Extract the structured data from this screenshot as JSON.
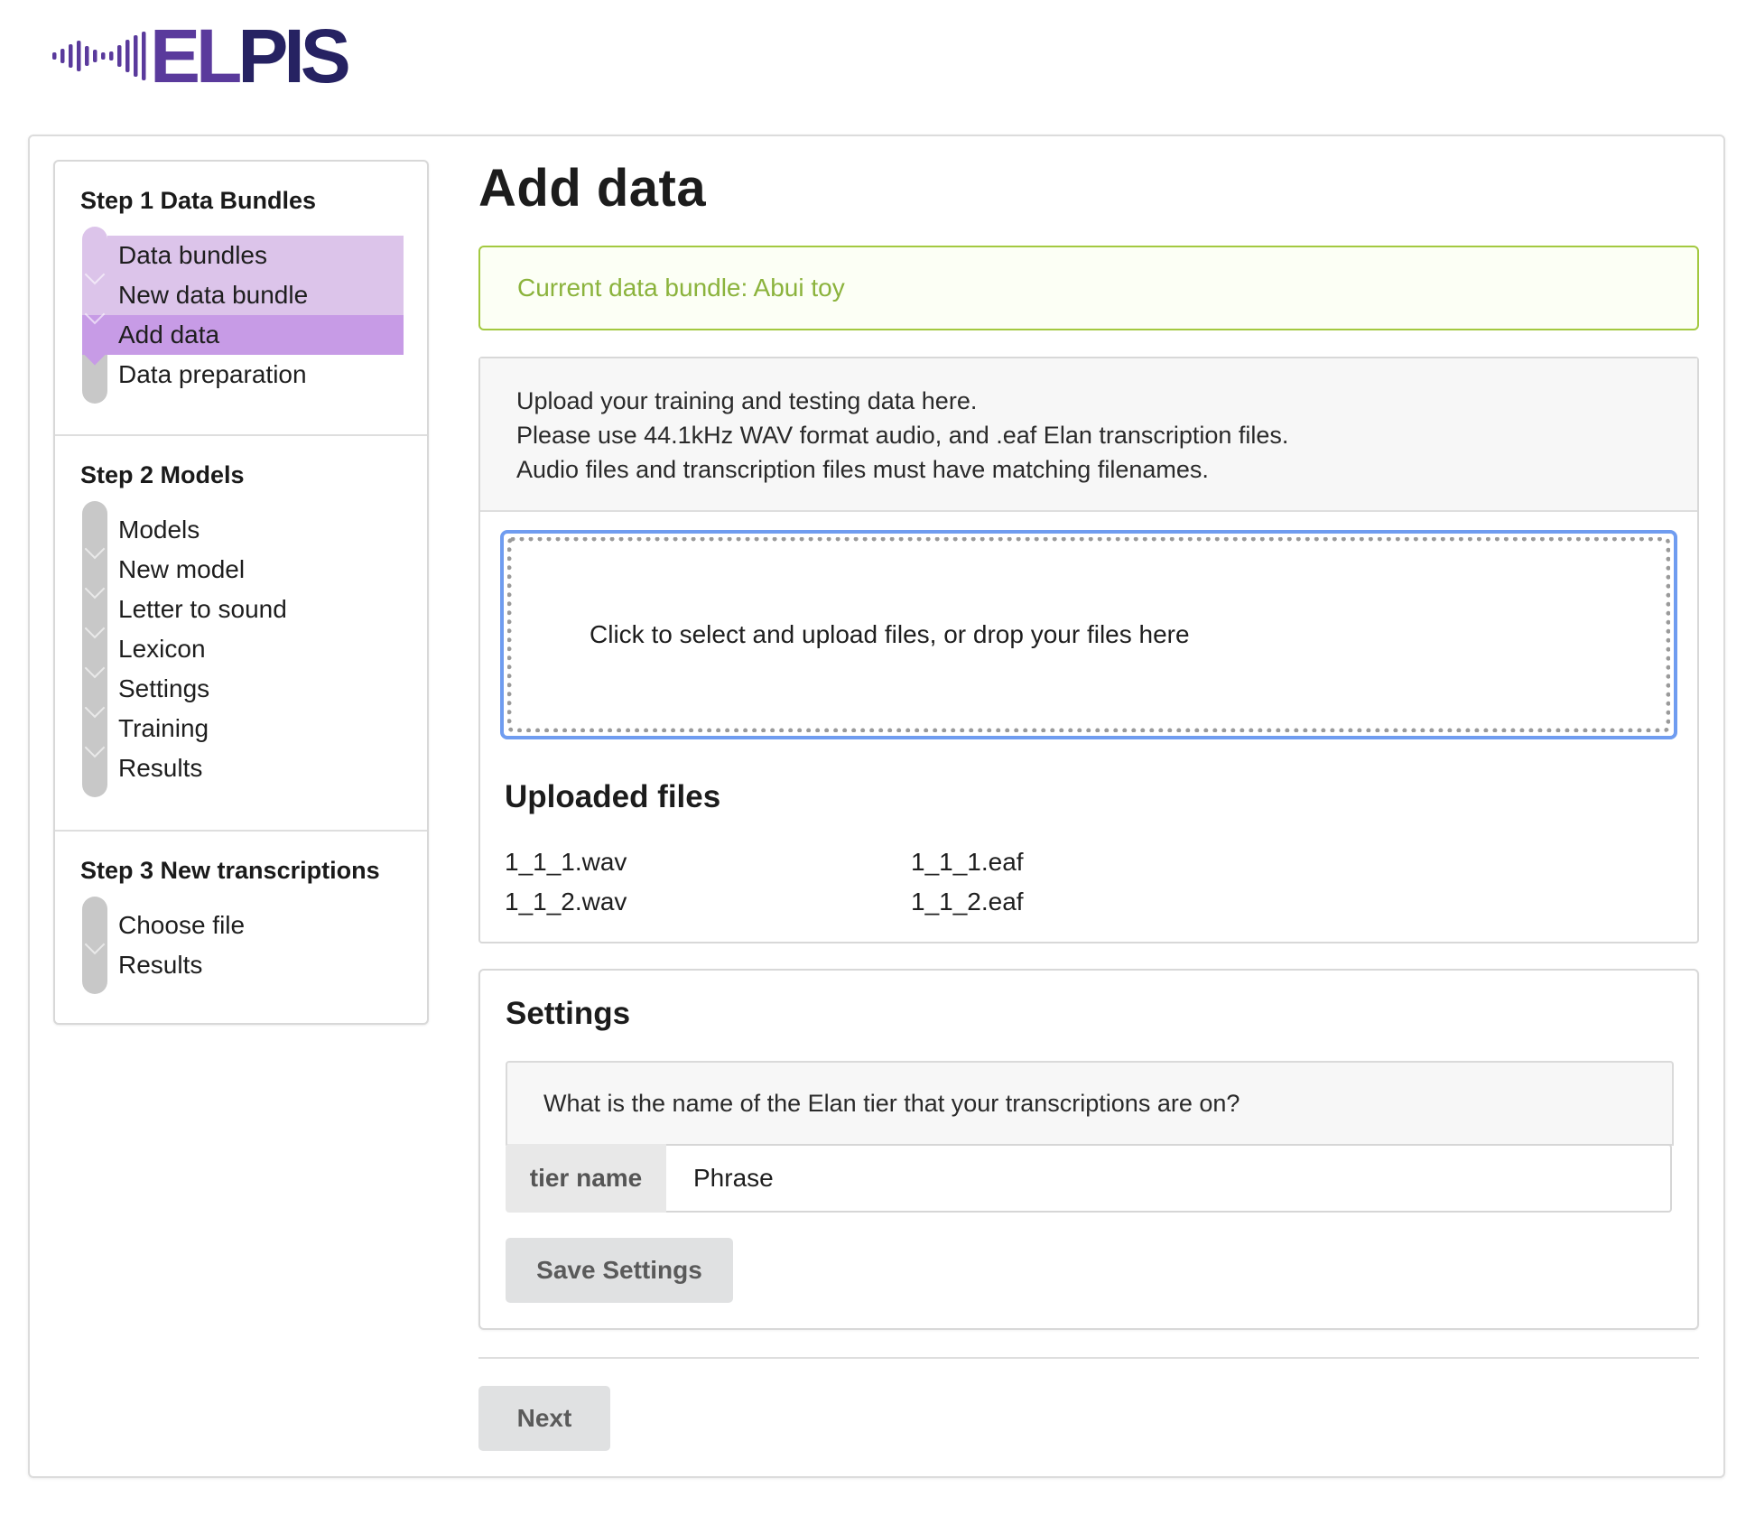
{
  "app": {
    "logo_text_a": "EL",
    "logo_text_b": "PIS",
    "brand_dark": "#262262",
    "brand_purple": "#5a3a9c"
  },
  "sidebar": {
    "steps": [
      {
        "title": "Step 1 Data Bundles",
        "items": [
          {
            "label": "Data bundles",
            "state": "done"
          },
          {
            "label": "New data bundle",
            "state": "done"
          },
          {
            "label": "Add data",
            "state": "active"
          },
          {
            "label": "Data preparation",
            "state": "todo"
          }
        ]
      },
      {
        "title": "Step 2 Models",
        "items": [
          {
            "label": "Models",
            "state": "todo"
          },
          {
            "label": "New model",
            "state": "todo"
          },
          {
            "label": "Letter to sound",
            "state": "todo"
          },
          {
            "label": "Lexicon",
            "state": "todo"
          },
          {
            "label": "Settings",
            "state": "todo"
          },
          {
            "label": "Training",
            "state": "todo"
          },
          {
            "label": "Results",
            "state": "todo"
          }
        ]
      },
      {
        "title": "Step 3 New transcriptions",
        "items": [
          {
            "label": "Choose file",
            "state": "todo"
          },
          {
            "label": "Results",
            "state": "todo"
          }
        ]
      }
    ],
    "colors": {
      "done": "#dcc4ea",
      "active": "#c79be6",
      "rail": "#c8c8c8"
    }
  },
  "main": {
    "title": "Add data",
    "current_bundle": "Current data bundle: Abui toy",
    "upload": {
      "info_lines": [
        "Upload your training and testing data here.",
        "Please use 44.1kHz WAV format audio, and .eaf Elan transcription files.",
        "Audio files and transcription files must have matching filenames."
      ],
      "dropzone_text": "Click to select and upload files, or drop your files here",
      "uploaded_title": "Uploaded files",
      "files": [
        [
          "1_1_1.wav",
          "1_1_1.eaf"
        ],
        [
          "1_1_2.wav",
          "1_1_2.eaf"
        ]
      ]
    },
    "settings": {
      "title": "Settings",
      "question": "What is the name of the Elan tier that your transcriptions are on?",
      "tier_label": "tier name",
      "tier_value": "Phrase",
      "save_label": "Save Settings"
    },
    "next_label": "Next"
  }
}
